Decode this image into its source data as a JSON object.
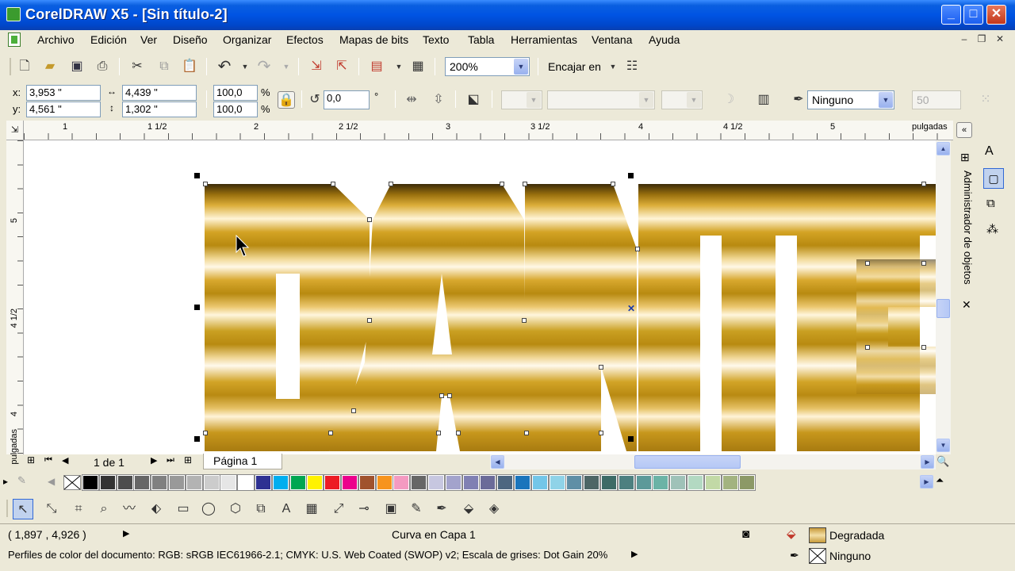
{
  "window": {
    "title": "CorelDRAW X5 - [Sin título-2]"
  },
  "menu": [
    "Archivo",
    "Edición",
    "Ver",
    "Diseño",
    "Organizar",
    "Efectos",
    "Mapas de bits",
    "Texto",
    "Tabla",
    "Herramientas",
    "Ventana",
    "Ayuda"
  ],
  "standard_toolbar": {
    "zoom_value": "200%",
    "snap_label": "Encajar en"
  },
  "property_bar": {
    "x_label": "x:",
    "x_value": "3,953 \"",
    "y_label": "y:",
    "y_value": "4,561 \"",
    "w_value": "4,439 \"",
    "h_value": "1,302 \"",
    "scale_x": "100,0",
    "scale_y": "100,0",
    "percent": "%",
    "rotation": "0,0",
    "degree": "°",
    "outline_value": "Ninguno",
    "disabled_value": "50"
  },
  "ruler": {
    "unit": "pulgadas",
    "h_labels": [
      "1",
      "1 1/2",
      "2",
      "2 1/2",
      "3",
      "3 1/2",
      "4",
      "4 1/2",
      "5"
    ],
    "v_labels": [
      "5",
      "4 1/2",
      "4",
      "pulgadas"
    ]
  },
  "page_nav": {
    "counter": "1 de 1",
    "tab": "Página 1"
  },
  "docker": {
    "title": "Administrador de objetos"
  },
  "palette_colors": [
    "#000000",
    "#333333",
    "#4d4d4d",
    "#666666",
    "#808080",
    "#999999",
    "#b3b3b3",
    "#cccccc",
    "#e6e6e6",
    "#ffffff",
    "#2e3192",
    "#00aeef",
    "#00a651",
    "#fff200",
    "#ed1c24",
    "#ec008c",
    "#a0522d",
    "#f7941d",
    "#f49ac1",
    "#666666",
    "#c7c7e0",
    "#a3a3cc",
    "#8080b3",
    "#6b6b99",
    "#4d6680",
    "#1b75bc",
    "#73c6e8",
    "#8fd3e8",
    "#5f8fa6",
    "#4d6666",
    "#3d6b66",
    "#4d8080",
    "#5c9999",
    "#6bb3a6",
    "#9fc2b8",
    "#b3d9c2",
    "#c2d9a6",
    "#a3b380",
    "#8c9966"
  ],
  "status": {
    "coords": "( 1,897 , 4,926  )",
    "object": "Curva en Capa 1",
    "fill_label": "Degradada",
    "outline_label": "Ninguno",
    "color_profile": "Perfiles de color del documento: RGB: sRGB IEC61966-2.1; CMYK: U.S. Web Coated (SWOP) v2; Escala de grises: Dot Gain 20%"
  }
}
